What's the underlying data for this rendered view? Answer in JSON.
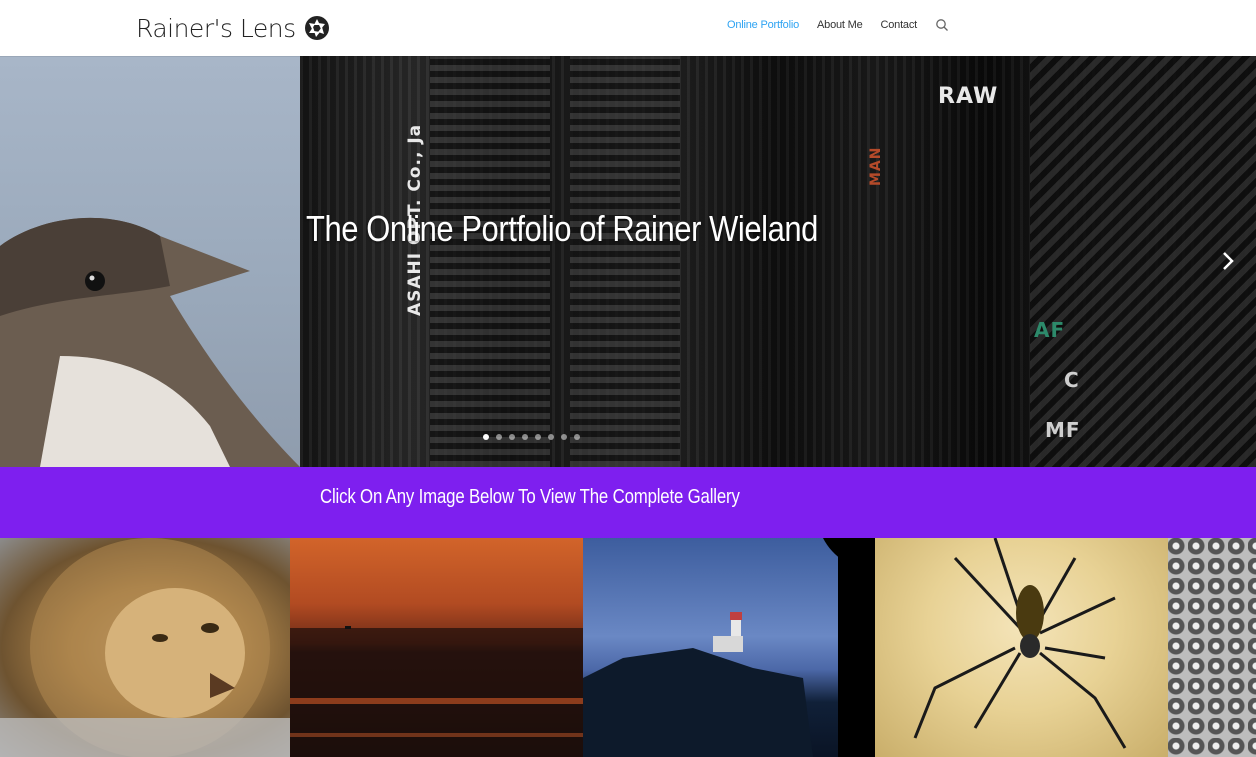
{
  "header": {
    "logo_text": "Rainer's Lens",
    "logo_icon": "camera-aperture-icon",
    "nav": [
      {
        "label": "Online Portfolio",
        "active": true
      },
      {
        "label": "About Me",
        "active": false
      },
      {
        "label": "Contact",
        "active": false
      }
    ],
    "search_icon": "search-icon",
    "accent_color": "#2ea3f2"
  },
  "hero": {
    "title": "The Online Portfolio of Rainer Wieland",
    "camera_labels": [
      "ASAHI OPT. Co., Ja",
      "RAW",
      "MAN",
      "AF",
      "C",
      "MF"
    ],
    "next_icon": "chevron-right-icon",
    "slide_count": 8,
    "active_slide": 1
  },
  "band": {
    "text": "Click On Any Image Below To View The Complete Gallery",
    "color": "#7e1fef"
  },
  "gallery": {
    "tiles": [
      "lion",
      "sunset",
      "lighthouse",
      "spider",
      "metal"
    ]
  }
}
